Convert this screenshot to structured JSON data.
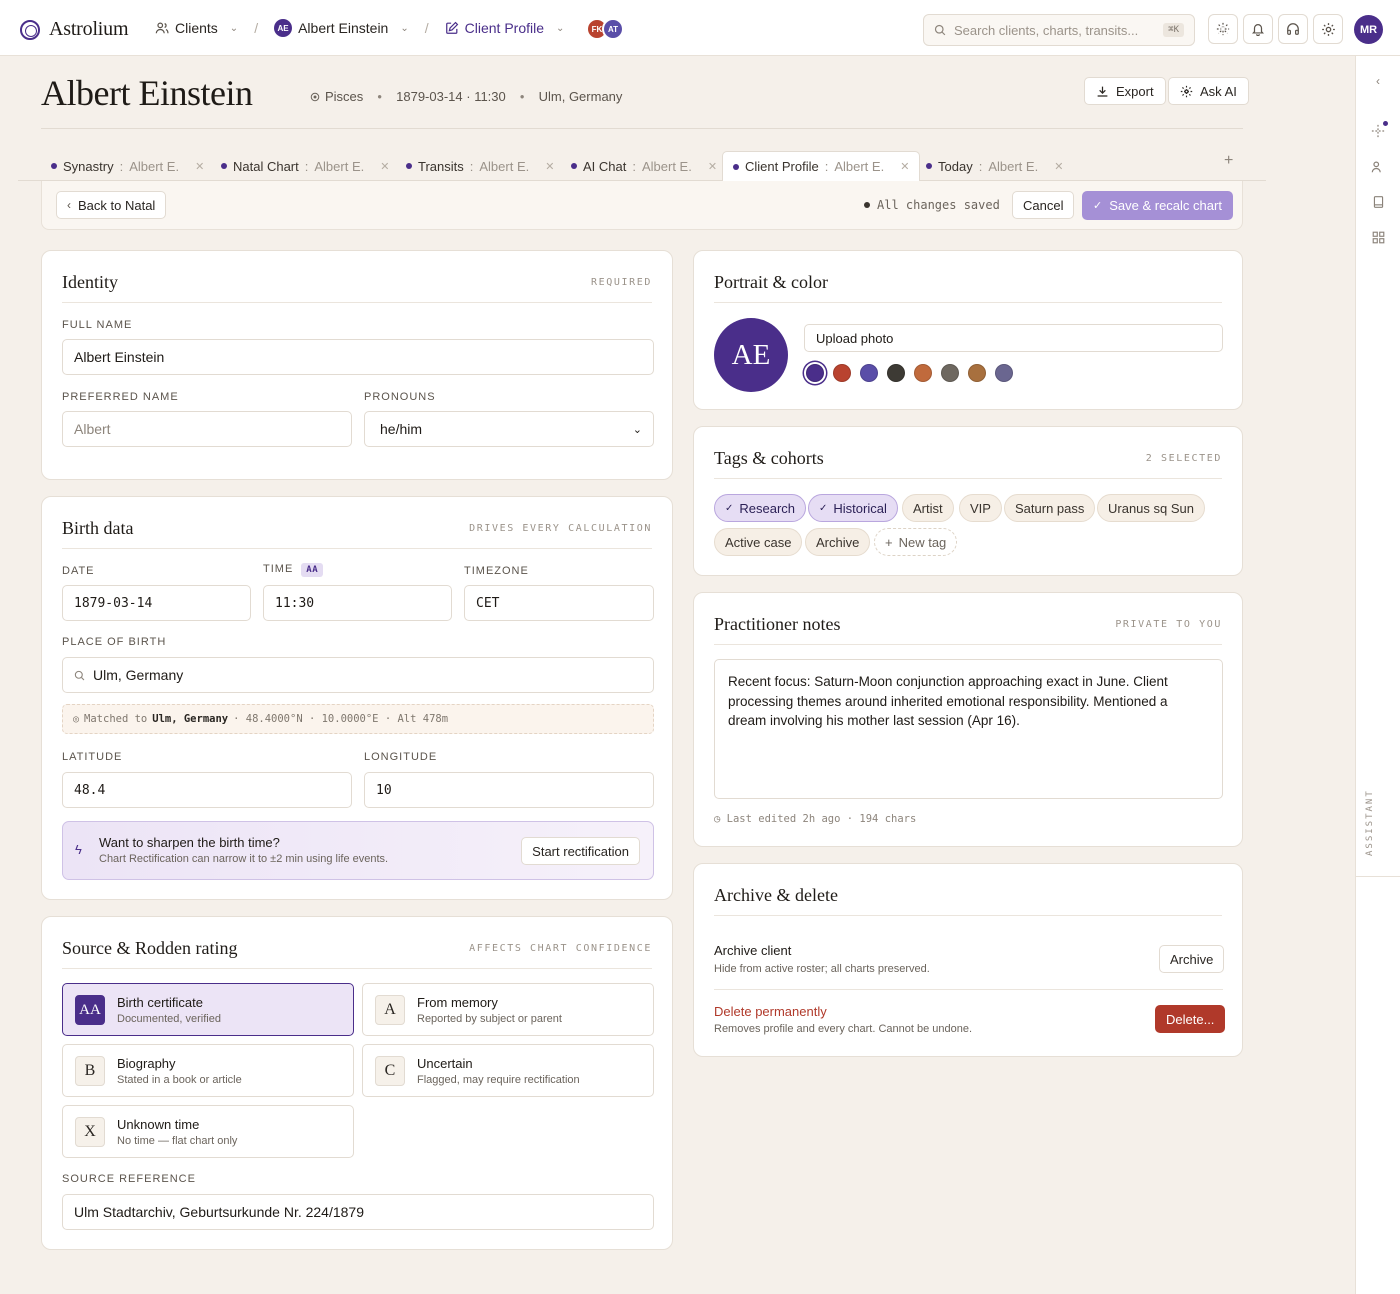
{
  "app": {
    "name": "Astrolium"
  },
  "breadcrumb": {
    "clients": "Clients",
    "client_initials": "AE",
    "client": "Albert Einstein",
    "page": "Client Profile"
  },
  "presence": [
    "FK",
    "AT"
  ],
  "search": {
    "placeholder": "Search clients, charts, transits...",
    "shortcut": "⌘K"
  },
  "user": {
    "initials": "MR"
  },
  "header": {
    "title": "Albert Einstein",
    "sign": "Pisces",
    "birth": "1879-03-14 · 11:30",
    "place": "Ulm, Germany",
    "export": "Export",
    "ask_ai": "Ask AI"
  },
  "tabs": [
    {
      "label": "Synastry",
      "who": "Albert E."
    },
    {
      "label": "Natal Chart",
      "who": "Albert E."
    },
    {
      "label": "Transits",
      "who": "Albert E."
    },
    {
      "label": "AI Chat",
      "who": "Albert E."
    },
    {
      "label": "Client Profile",
      "who": "Albert E."
    },
    {
      "label": "Today",
      "who": "Albert E."
    }
  ],
  "actionbar": {
    "back": "Back to Natal",
    "saved": "All changes saved",
    "cancel": "Cancel",
    "save": "Save & recalc chart"
  },
  "identity": {
    "title": "Identity",
    "tag": "REQUIRED",
    "full_name_label": "FULL NAME",
    "full_name": "Albert Einstein",
    "preferred_label": "PREFERRED NAME",
    "preferred_placeholder": "Albert",
    "pronouns_label": "PRONOUNS",
    "pronouns": "he/him"
  },
  "birth": {
    "title": "Birth data",
    "tag": "DRIVES EVERY CALCULATION",
    "date_label": "DATE",
    "date": "1879-03-14",
    "time_label": "TIME",
    "time_badge": "AA",
    "time": "11:30",
    "tz_label": "TIMEZONE",
    "tz": "CET",
    "place_label": "PLACE OF BIRTH",
    "place": "Ulm, Germany",
    "matched_prefix": "Matched to",
    "matched_place": "Ulm, Germany",
    "matched_rest": "· 48.4000°N · 10.0000°E · Alt 478m",
    "lat_label": "LATITUDE",
    "lat": "48.4",
    "lon_label": "LONGITUDE",
    "lon": "10",
    "rectify_title": "Want to sharpen the birth time?",
    "rectify_sub": "Chart Rectification can narrow it to ±2 min using life events.",
    "rectify_btn": "Start rectification"
  },
  "source": {
    "title": "Source & Rodden rating",
    "tag": "AFFECTS CHART CONFIDENCE",
    "ratings": [
      {
        "code": "AA",
        "title": "Birth certificate",
        "sub": "Documented, verified"
      },
      {
        "code": "A",
        "title": "From memory",
        "sub": "Reported by subject or parent"
      },
      {
        "code": "B",
        "title": "Biography",
        "sub": "Stated in a book or article"
      },
      {
        "code": "C",
        "title": "Uncertain",
        "sub": "Flagged, may require rectification"
      },
      {
        "code": "X",
        "title": "Unknown time",
        "sub": "No time — flat chart only"
      }
    ],
    "ref_label": "SOURCE REFERENCE",
    "ref": "Ulm Stadtarchiv, Geburtsurkunde Nr. 224/1879"
  },
  "portrait": {
    "title": "Portrait & color",
    "initials": "AE",
    "upload": "Upload photo",
    "colors": [
      "#4a2e8a",
      "#b9432f",
      "#5a4ea8",
      "#3d3a34",
      "#c06a3c",
      "#6e6860",
      "#a8703e",
      "#6a6690"
    ]
  },
  "tags": {
    "title": "Tags & cohorts",
    "tag": "2 SELECTED",
    "items": [
      "Research",
      "Historical",
      "Artist",
      "VIP",
      "Saturn pass",
      "Uranus sq Sun",
      "Active case",
      "Archive"
    ],
    "new": "New tag"
  },
  "notes": {
    "title": "Practitioner notes",
    "tag": "PRIVATE TO YOU",
    "text": "Recent focus: Saturn-Moon conjunction approaching exact in June. Client processing themes around inherited emotional responsibility. Mentioned a dream involving his mother last session (Apr 16).",
    "meta": "Last edited 2h ago · 194 chars"
  },
  "archive": {
    "title": "Archive & delete",
    "archive_title": "Archive client",
    "archive_sub": "Hide from active roster; all charts preserved.",
    "archive_btn": "Archive",
    "delete_title": "Delete permanently",
    "delete_sub": "Removes profile and every chart. Cannot be undone.",
    "delete_btn": "Delete..."
  },
  "rail": {
    "label": "ASSISTANT"
  }
}
